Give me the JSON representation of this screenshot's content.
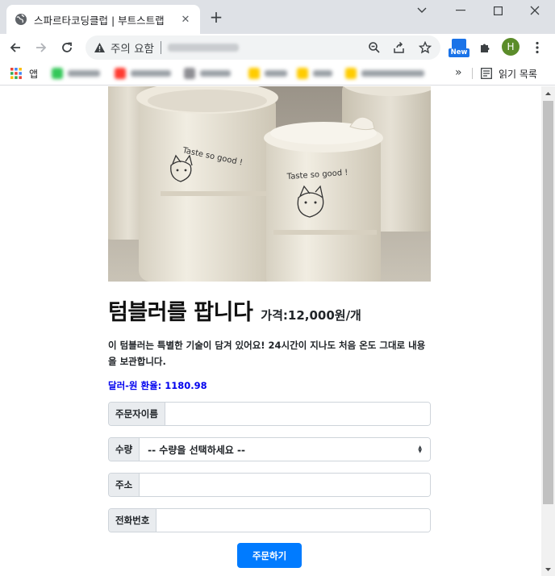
{
  "browser": {
    "tab_title": "스파르타코딩클럽 | 부트스트랩",
    "address_warning": "주의 요함",
    "new_badge": "New",
    "avatar_initial": "H",
    "bookmarks_apps": "앱",
    "bookmarks_more": "»",
    "reading_list": "읽기 목록"
  },
  "product": {
    "title": "텀블러를 팝니다",
    "price": "가격:12,000원/개",
    "description": "이 텀블러는 특별한 기술이 담겨 있어요! 24시간이 지나도 처음 온도 그대로 내용을 보관합니다.",
    "rate_label": "달러-원 환율:",
    "rate_value": "1180.98"
  },
  "form": {
    "name_label": "주문자이름",
    "qty_label": "수량",
    "qty_selected": "-- 수량을 선택하세요 --",
    "address_label": "주소",
    "phone_label": "전화번호",
    "submit_label": "주문하기"
  },
  "colors": {
    "primary": "#007bff",
    "rate_link": "#0000ee",
    "chrome_frame": "#dee1e6"
  }
}
